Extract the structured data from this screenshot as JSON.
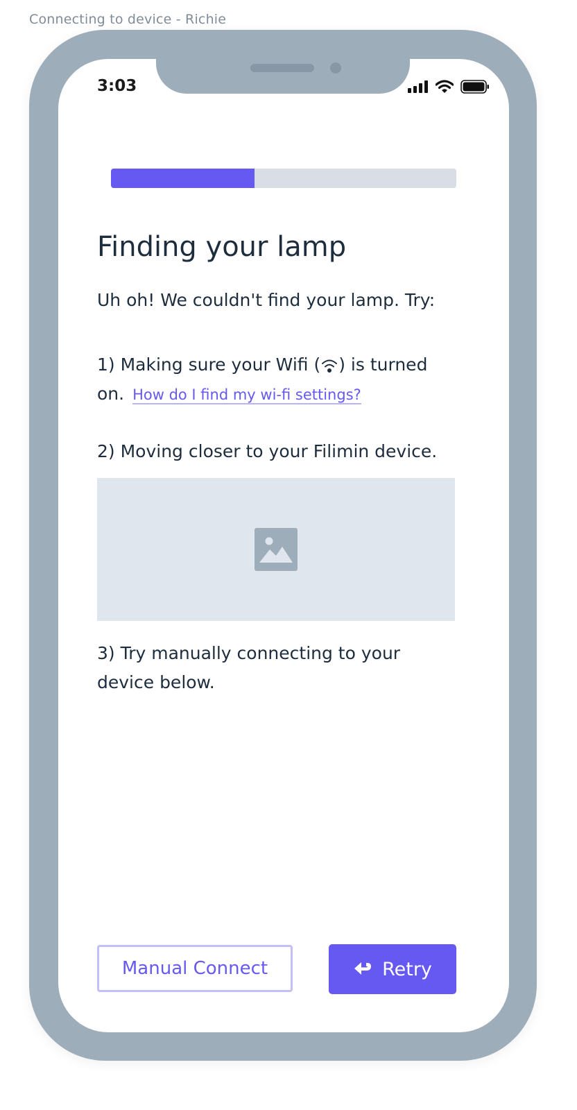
{
  "frame": {
    "caption": "Connecting to device - Richie"
  },
  "status_bar": {
    "time": "3:03",
    "icons": [
      "signal-icon",
      "wifi-icon",
      "battery-icon"
    ]
  },
  "progress": {
    "fraction": 0.416
  },
  "page": {
    "title": "Finding your lamp",
    "intro": "Uh oh! We couldn't find your lamp. Try:",
    "step1": {
      "before_icon": "1) Making sure your Wifi (",
      "icon": "wifi-icon",
      "after_icon": ") is turned on.",
      "link": "How do I find my wi-fi settings?"
    },
    "step2": "2) Moving closer to your Filimin device.",
    "image_placeholder_icon": "image-icon",
    "step3": "3) Try manually connecting to your device below."
  },
  "buttons": {
    "manual_connect": "Manual Connect",
    "retry": "Retry",
    "retry_icon": "return-arrow-icon"
  },
  "colors": {
    "accent": "#6659f2",
    "phone_frame": "#9eadba",
    "text": "#1d2d3e",
    "progress_track": "#d8dde6",
    "placeholder": "#e0e6ee"
  }
}
